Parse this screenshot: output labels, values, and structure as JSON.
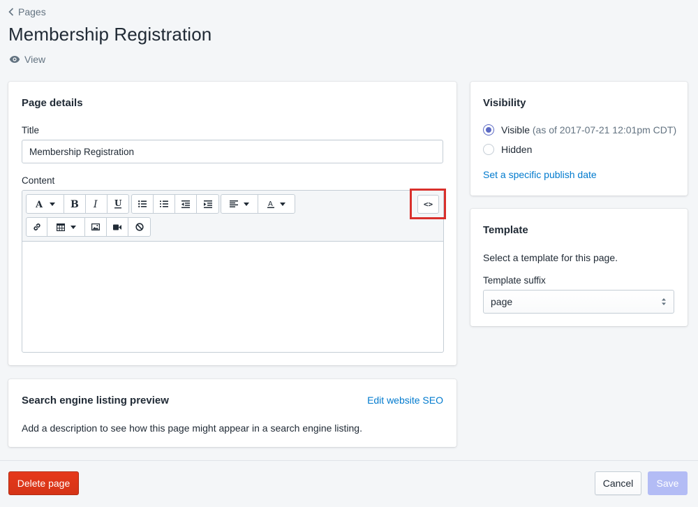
{
  "breadcrumb": {
    "label": "Pages"
  },
  "page": {
    "title": "Membership Registration",
    "view_label": "View"
  },
  "page_details": {
    "heading": "Page details",
    "title_label": "Title",
    "title_value": "Membership Registration",
    "content_label": "Content",
    "editor_toolbar": {
      "row1": [
        "font-style-icon",
        "bold-icon",
        "italic-icon",
        "underline-icon",
        "bulleted-list-icon",
        "numbered-list-icon",
        "outdent-icon",
        "indent-icon",
        "align-icon",
        "text-color-icon"
      ],
      "row2": [
        "link-icon",
        "table-icon",
        "image-icon",
        "video-icon",
        "clear-format-icon"
      ],
      "html_toggle": "<>"
    }
  },
  "seo": {
    "heading": "Search engine listing preview",
    "edit_link": "Edit website SEO",
    "description": "Add a description to see how this page might appear in a search engine listing."
  },
  "visibility": {
    "heading": "Visibility",
    "visible_label": "Visible",
    "visible_note": "(as of 2017-07-21 12:01pm CDT)",
    "hidden_label": "Hidden",
    "publish_link": "Set a specific publish date",
    "selected": "visible"
  },
  "template": {
    "heading": "Template",
    "description": "Select a template for this page.",
    "suffix_label": "Template suffix",
    "suffix_value": "page"
  },
  "footer": {
    "delete_label": "Delete page",
    "cancel_label": "Cancel",
    "save_label": "Save"
  },
  "colors": {
    "primary_link": "#007ace",
    "radio_accent": "#5c6ac4",
    "danger": "#de3618",
    "save_disabled": "#b3bcf5",
    "highlight": "#d9302c"
  }
}
